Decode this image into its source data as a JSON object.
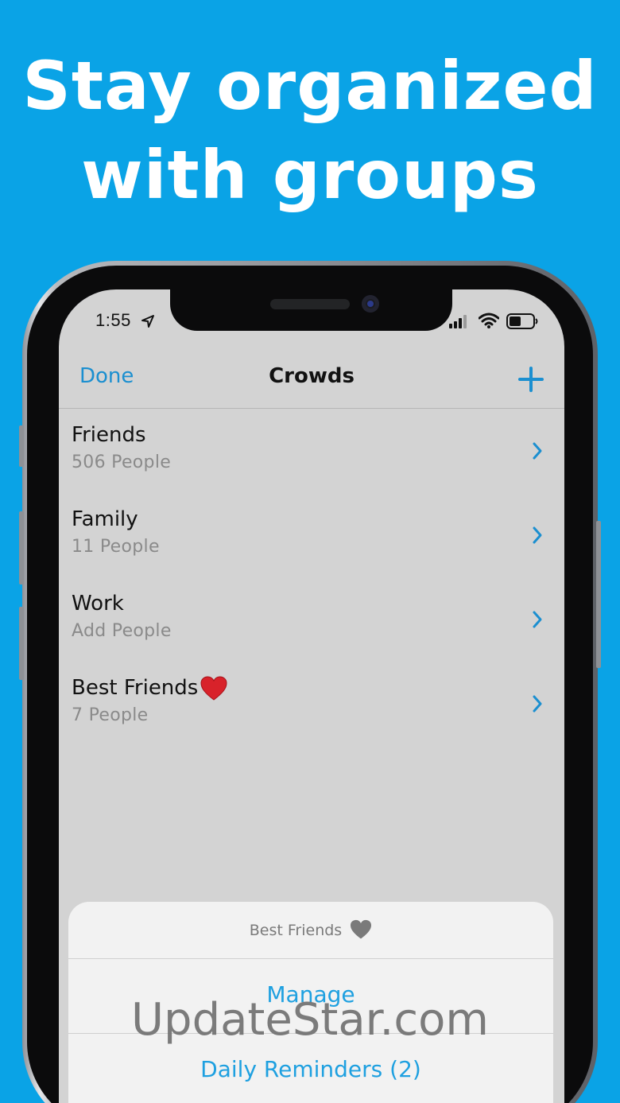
{
  "promo": {
    "headline_line1": "Stay organized",
    "headline_line2": "with groups"
  },
  "status_bar": {
    "time": "1:55"
  },
  "navbar": {
    "done_label": "Done",
    "title": "Crowds"
  },
  "groups": [
    {
      "name": "Friends",
      "subtitle": "506 People"
    },
    {
      "name": "Family",
      "subtitle": "11 People"
    },
    {
      "name": "Work",
      "subtitle": "Add People"
    },
    {
      "name": "Best Friends",
      "subtitle": "7 People"
    }
  ],
  "action_sheet": {
    "title": "Best Friends",
    "actions": [
      "Manage",
      "Daily Reminders (2)"
    ]
  },
  "watermark": "UpdateStar.com",
  "colors": {
    "background": "#0aa3e6",
    "accent": "#1b8fd0",
    "screen_bg": "#d3d3d3"
  }
}
